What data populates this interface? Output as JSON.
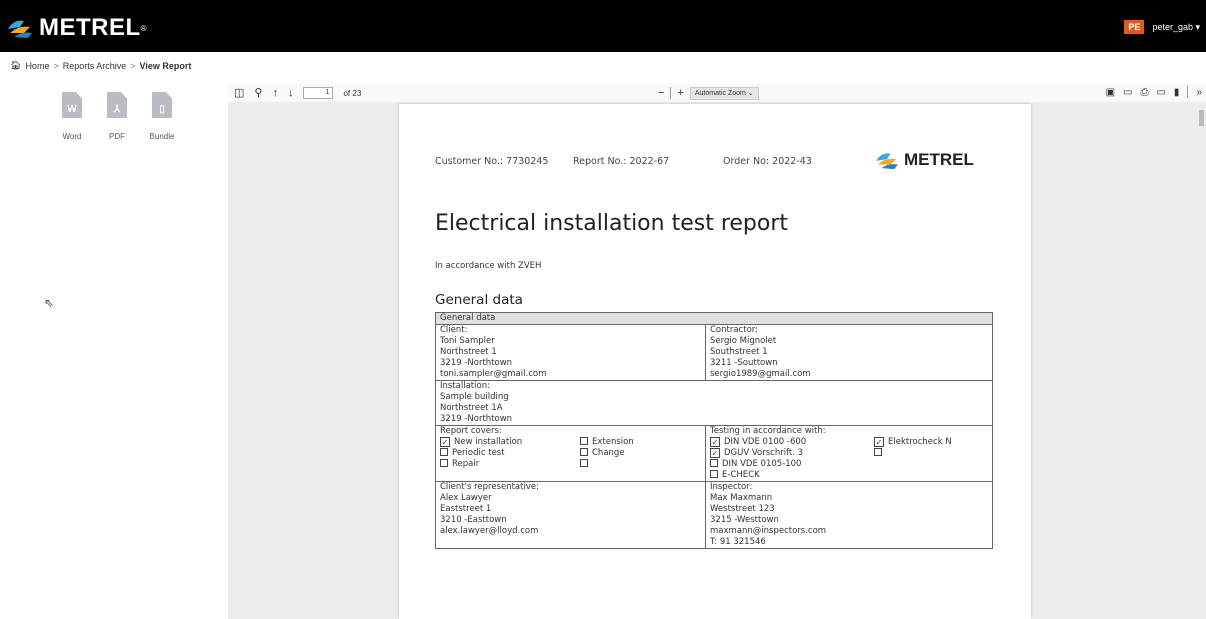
{
  "brand": {
    "name": "METREL",
    "reg": "®"
  },
  "user": {
    "badge": "PE",
    "name": "peter_gab ▾"
  },
  "breadcrumb": {
    "home": "Home",
    "archive": "Reports Archive",
    "current": "View Report",
    "sep": ">"
  },
  "downloads": [
    {
      "label": "Word",
      "glyph": "W",
      "icon": "word-file-icon"
    },
    {
      "label": "PDF",
      "glyph": "⅄",
      "icon": "pdf-file-icon"
    },
    {
      "label": "Bundle",
      "glyph": "▯",
      "icon": "bundle-file-icon"
    }
  ],
  "viewer": {
    "page_current": "1",
    "page_total": "of 23",
    "zoom_minus": "−",
    "zoom_plus": "+",
    "zoom_label": "Automatic Zoom",
    "more": "»"
  },
  "report": {
    "customer": "Customer No.: 7730245",
    "report_no": "Report No.: 2022-67",
    "order": "Order No: 2022-43",
    "logo": "METREL",
    "title": "Electrical installation test report",
    "subtitle": "In accordance with ZVEH",
    "section": "General data",
    "table_header": "General data",
    "client": [
      "Client:",
      "Toni Sampler",
      "Northstreet 1",
      "3219 -Northtown",
      "toni.sampler@gmail.com"
    ],
    "contractor": [
      "Contractor:",
      "Sergio Mignolet",
      "Southstreet 1",
      "3211 -Souttown",
      "sergio1989@gmail.com"
    ],
    "installation": [
      "Installation:",
      "Sample building",
      "Northstreet 1A",
      "3219 -Northtown"
    ],
    "covers_label": "Report covers:",
    "covers": [
      {
        "label": "New installation",
        "checked": true
      },
      {
        "label": "Extension",
        "checked": false
      },
      {
        "label": "Periodic test",
        "checked": false
      },
      {
        "label": "Change",
        "checked": false
      },
      {
        "label": "Repair",
        "checked": false
      },
      {
        "label": "",
        "checked": false
      }
    ],
    "testing_label": "Testing in accordance with:",
    "testing": [
      {
        "label": "DIN VDE 0100 -600",
        "checked": true
      },
      {
        "label": "Elektrocheck N",
        "checked": true
      },
      {
        "label": "DGUV Vorschrift. 3",
        "checked": true
      },
      {
        "label": "",
        "checked": false
      },
      {
        "label": "DIN VDE 0105-100",
        "checked": false
      },
      {
        "label": "",
        "checked": null
      },
      {
        "label": "E-CHECK",
        "checked": false
      }
    ],
    "client_rep": [
      "Client's representative:",
      "Alex Lawyer",
      "Eaststreet 1",
      "3210 -Easttown",
      "alex.lawyer@lloyd.com"
    ],
    "inspector": [
      "Inspector:",
      "Max  Maxmann",
      "Weststreet 123",
      "3215 -Westtown",
      "maxmann@inspectors.com",
      "T: 91 321546"
    ]
  }
}
